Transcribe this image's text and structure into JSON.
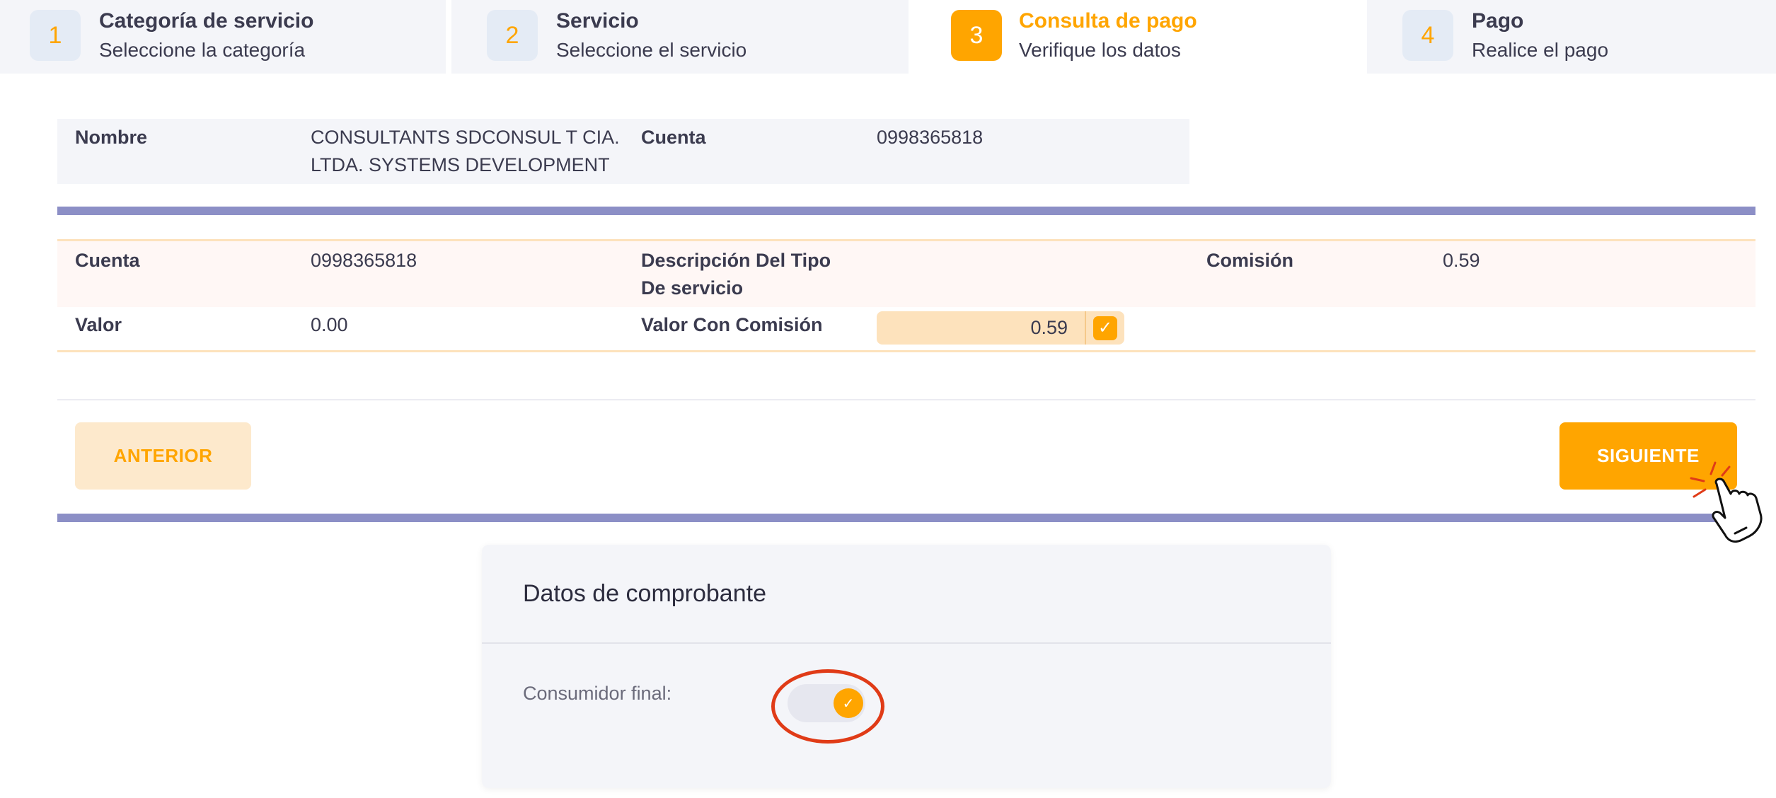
{
  "stepper": {
    "steps": [
      {
        "number": "1",
        "title": "Categoría de servicio",
        "subtitle": "Seleccione la categoría"
      },
      {
        "number": "2",
        "title": "Servicio",
        "subtitle": "Seleccione el servicio"
      },
      {
        "number": "3",
        "title": "Consulta de pago",
        "subtitle": "Verifique los datos"
      },
      {
        "number": "4",
        "title": "Pago",
        "subtitle": "Realice el pago"
      }
    ],
    "active_step": 3
  },
  "client": {
    "name_label": "Nombre",
    "name_line1": "CONSULTANTS SDCONSUL T CIA.",
    "name_line2": "LTDA. SYSTEMS DEVELOPMENT",
    "account_label": "Cuenta",
    "account_value": "0998365818"
  },
  "detail": {
    "account_label": "Cuenta",
    "account_value": "0998365818",
    "service_desc_label_line1": "Descripción Del Tipo",
    "service_desc_label_line2": "De servicio",
    "commission_label": "Comisión",
    "commission_value": "0.59",
    "value_label": "Valor",
    "value_value": "0.00",
    "value_with_commission_label": "Valor Con Comisión",
    "value_with_commission_amount": "0.59",
    "value_with_commission_checked": true
  },
  "actions": {
    "prev_label": "ANTERIOR",
    "next_label": "SIGUIENTE"
  },
  "receipt": {
    "title": "Datos de comprobante",
    "final_consumer_label": "Consumidor final:",
    "final_consumer_enabled": true
  },
  "colors": {
    "accent": "#ffa500",
    "bar": "#8c8fc6",
    "highlight": "#e03b17"
  }
}
